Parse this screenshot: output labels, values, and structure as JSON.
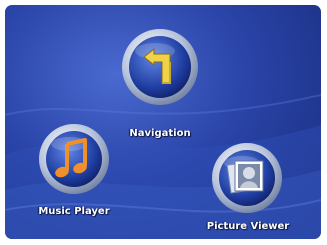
{
  "menu": {
    "items": [
      {
        "id": "navigation",
        "label": "Navigation",
        "icon": "navigation-arrow-icon"
      },
      {
        "id": "music-player",
        "label": "Music Player",
        "icon": "music-note-icon"
      },
      {
        "id": "picture-viewer",
        "label": "Picture Viewer",
        "icon": "picture-icon"
      }
    ]
  },
  "colors": {
    "background": "#2a44a8",
    "ring": "#cfd8ea",
    "note": "#f0902a",
    "arrow": "#f0d24a"
  }
}
